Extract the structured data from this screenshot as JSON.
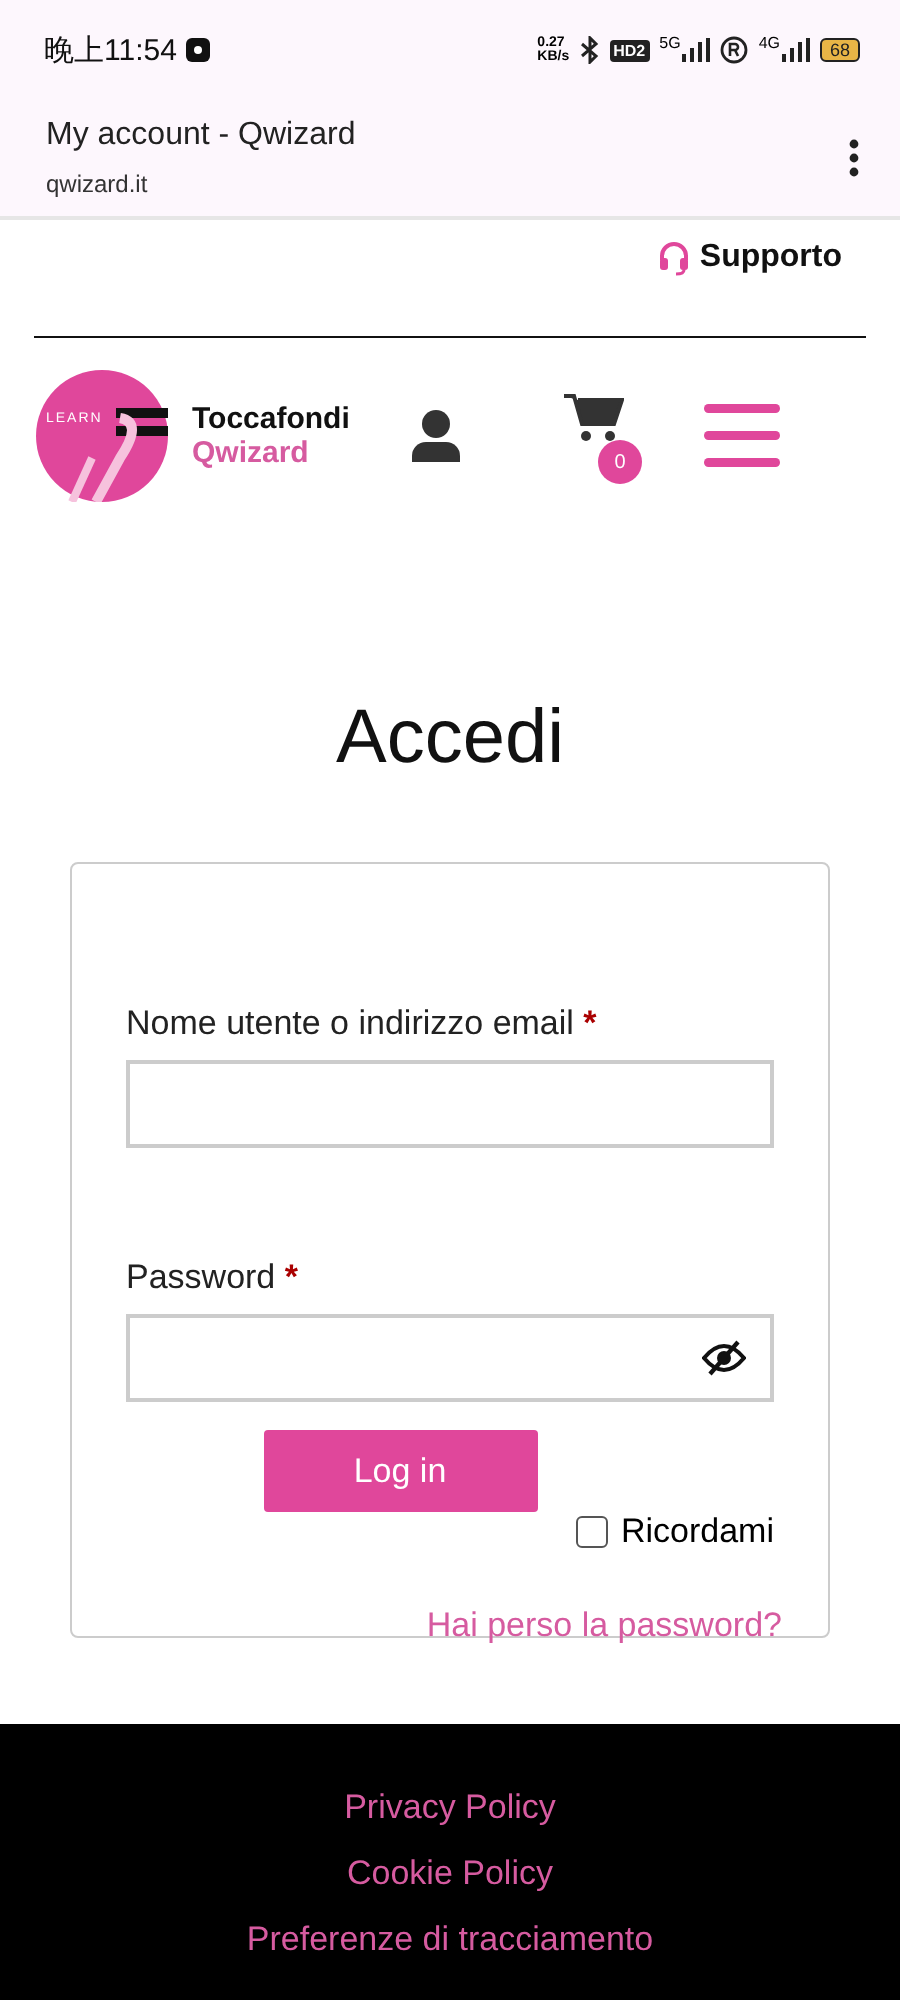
{
  "status_bar": {
    "time": "晚上11:54",
    "speed": "0.27\nKB/s",
    "hd": "HD2",
    "net_1": "5G",
    "net_2": "4G",
    "battery": "68"
  },
  "browser": {
    "title": "My account - Qwizard",
    "url": "qwizard.it"
  },
  "topbar": {
    "support": "Supporto"
  },
  "header": {
    "logo_badge": "LEARN",
    "brand_1": "Toccafondi",
    "brand_2": "Qwizard",
    "cart_count": "0"
  },
  "login": {
    "heading": "Accedi",
    "fields": [
      {
        "label": "Nome utente o indirizzo email",
        "required": "*",
        "kind": "text"
      },
      {
        "label": "Password",
        "required": "*",
        "kind": "password"
      }
    ],
    "button": "Log in",
    "remember": {
      "label": "Ricordami",
      "checked": false
    },
    "lost": "Hai perso la password?"
  },
  "footer": {
    "links": [
      "Privacy Policy",
      "Cookie Policy",
      "Preferenze di tracciamento"
    ]
  }
}
